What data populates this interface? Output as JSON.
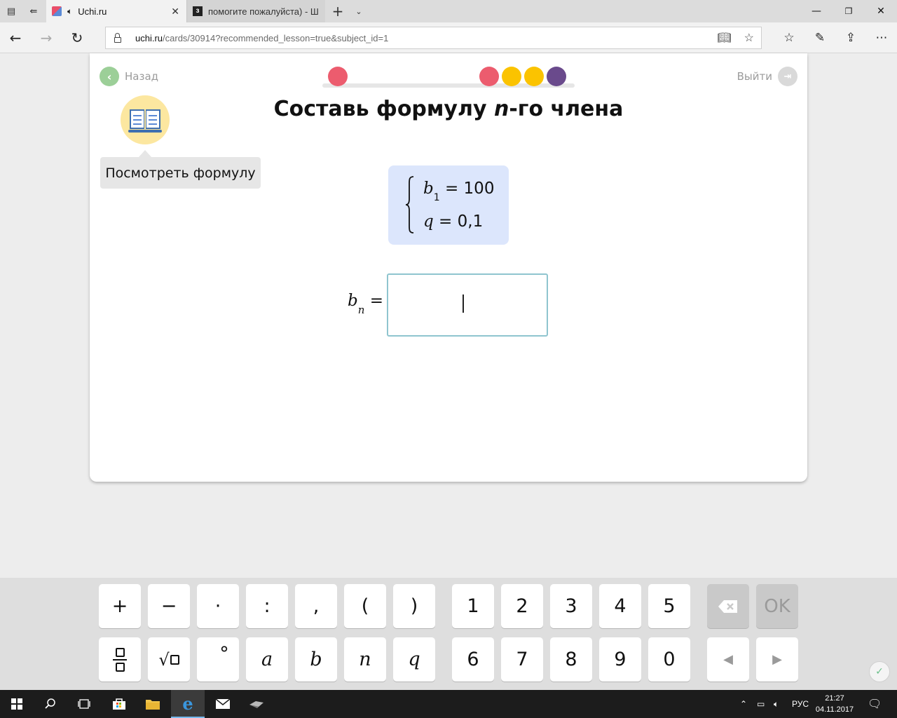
{
  "browser": {
    "tabs": [
      {
        "title": "Uchi.ru",
        "active": true
      },
      {
        "title": "помогите пожалуйста) - Ш",
        "active": false
      }
    ],
    "url_host": "uchi.ru",
    "url_path": "/cards/30914?recommended_lesson=true&subject_id=1"
  },
  "page": {
    "back_label": "Назад",
    "exit_label": "Выйти",
    "title_before": "Составь формулу ",
    "title_var": "n",
    "title_after": "-го члена",
    "tooltip": "Посмотреть формулу",
    "progress_dots": [
      {
        "color": "#ec5c6e"
      },
      {
        "color": "#ec5c6e"
      },
      {
        "color": "#fbc300"
      },
      {
        "color": "#fbc300"
      },
      {
        "color": "#6a4a8c"
      }
    ],
    "given": {
      "line1_var": "b",
      "line1_sub": "1",
      "line1_rest": " = 100",
      "line2_var": "q",
      "line2_rest": " = 0,1"
    },
    "answer": {
      "var": "b",
      "sub": "n",
      "eq": " ="
    }
  },
  "keypad": {
    "row1": [
      "+",
      "−",
      "·",
      ":",
      ",",
      "(",
      ")",
      "1",
      "2",
      "3",
      "4",
      "5"
    ],
    "row2_symbols": [
      "°"
    ],
    "row2_vars": [
      "a",
      "b",
      "n",
      "q"
    ],
    "row2_digits": [
      "6",
      "7",
      "8",
      "9",
      "0"
    ],
    "ok_label": "OK",
    "left_arrow": "◀",
    "right_arrow": "▶"
  },
  "taskbar": {
    "lang": "РУС",
    "time": "21:27",
    "date": "04.11.2017"
  },
  "colors": {
    "accent_green": "#9ccf98",
    "given_bg": "#dce6fc",
    "input_border": "#8fc5cf"
  }
}
